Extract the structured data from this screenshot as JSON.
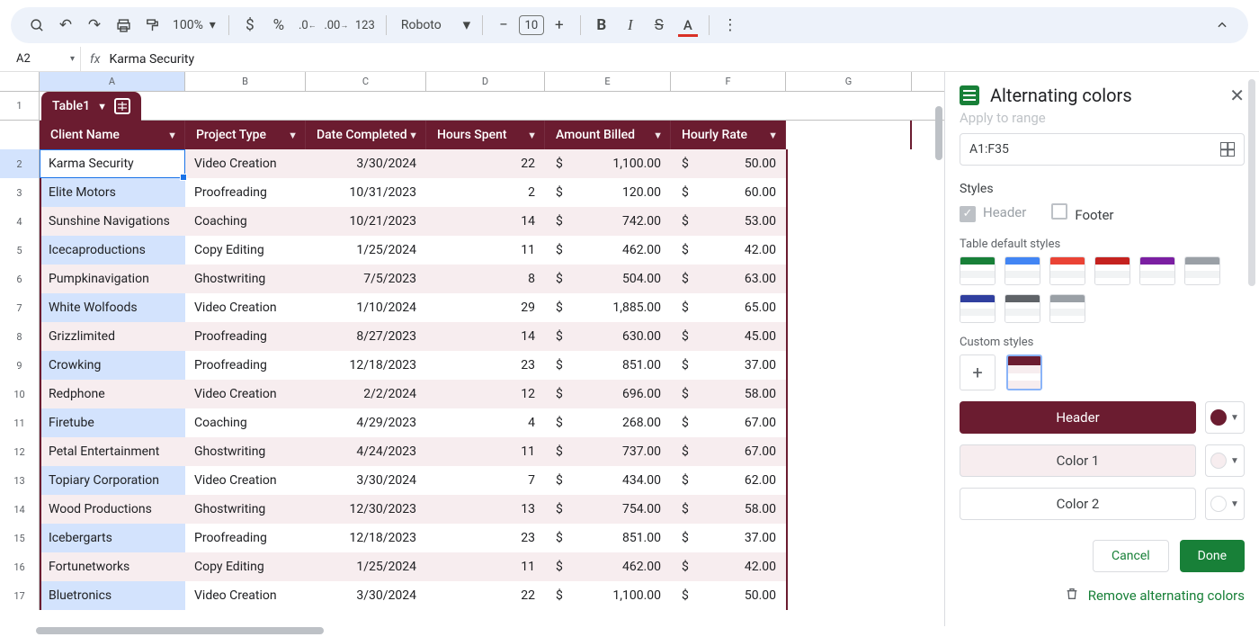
{
  "toolbar": {
    "zoom": "100%",
    "font": "Roboto",
    "font_size": "10",
    "numfmt_123": "123"
  },
  "formula_bar": {
    "cell_ref": "A2",
    "fx_label": "fx",
    "value": "Karma Security"
  },
  "columns": [
    "A",
    "B",
    "C",
    "D",
    "E",
    "F",
    "G"
  ],
  "table_chip": {
    "name": "Table1"
  },
  "headers": [
    "Client Name",
    "Project Type",
    "Date Completed",
    "Hours Spent",
    "Amount Billed",
    "Hourly Rate"
  ],
  "rows": [
    {
      "n": 2,
      "client": "Karma Security",
      "type": "Video Creation",
      "date": "3/30/2024",
      "hours": "22",
      "amount": "1,100.00",
      "rate": "50.00"
    },
    {
      "n": 3,
      "client": "Elite Motors",
      "type": "Proofreading",
      "date": "10/31/2023",
      "hours": "2",
      "amount": "120.00",
      "rate": "60.00"
    },
    {
      "n": 4,
      "client": "Sunshine Navigations",
      "type": "Coaching",
      "date": "10/21/2023",
      "hours": "14",
      "amount": "742.00",
      "rate": "53.00"
    },
    {
      "n": 5,
      "client": "Icecaproductions",
      "type": "Copy Editing",
      "date": "1/25/2024",
      "hours": "11",
      "amount": "462.00",
      "rate": "42.00"
    },
    {
      "n": 6,
      "client": "Pumpkinavigation",
      "type": "Ghostwriting",
      "date": "7/5/2023",
      "hours": "8",
      "amount": "504.00",
      "rate": "63.00"
    },
    {
      "n": 7,
      "client": "White Wolfoods",
      "type": "Video Creation",
      "date": "1/10/2024",
      "hours": "29",
      "amount": "1,885.00",
      "rate": "65.00"
    },
    {
      "n": 8,
      "client": "Grizzlimited",
      "type": "Proofreading",
      "date": "8/27/2023",
      "hours": "14",
      "amount": "630.00",
      "rate": "45.00"
    },
    {
      "n": 9,
      "client": "Crowking",
      "type": "Proofreading",
      "date": "12/18/2023",
      "hours": "23",
      "amount": "851.00",
      "rate": "37.00"
    },
    {
      "n": 10,
      "client": "Redphone",
      "type": "Video Creation",
      "date": "2/2/2024",
      "hours": "12",
      "amount": "696.00",
      "rate": "58.00"
    },
    {
      "n": 11,
      "client": "Firetube",
      "type": "Coaching",
      "date": "4/29/2023",
      "hours": "4",
      "amount": "268.00",
      "rate": "67.00"
    },
    {
      "n": 12,
      "client": "Petal Entertainment",
      "type": "Ghostwriting",
      "date": "4/24/2023",
      "hours": "11",
      "amount": "737.00",
      "rate": "67.00"
    },
    {
      "n": 13,
      "client": "Topiary Corporation",
      "type": "Video Creation",
      "date": "3/30/2024",
      "hours": "7",
      "amount": "434.00",
      "rate": "62.00"
    },
    {
      "n": 14,
      "client": "Wood Productions",
      "type": "Ghostwriting",
      "date": "12/30/2023",
      "hours": "13",
      "amount": "754.00",
      "rate": "58.00"
    },
    {
      "n": 15,
      "client": "Icebergarts",
      "type": "Proofreading",
      "date": "12/18/2023",
      "hours": "23",
      "amount": "851.00",
      "rate": "37.00"
    },
    {
      "n": 16,
      "client": "Fortunetworks",
      "type": "Copy Editing",
      "date": "1/25/2024",
      "hours": "11",
      "amount": "462.00",
      "rate": "42.00"
    },
    {
      "n": 17,
      "client": "Bluetronics",
      "type": "Video Creation",
      "date": "3/30/2024",
      "hours": "22",
      "amount": "1,100.00",
      "rate": "50.00"
    }
  ],
  "panel": {
    "title": "Alternating colors",
    "apply_label_cut": "Apply to range",
    "range": "A1:F35",
    "styles_label": "Styles",
    "header_chk": "Header",
    "footer_chk": "Footer",
    "default_label": "Table default styles",
    "default_colors": [
      "#188038",
      "#4285f4",
      "#ea4335",
      "#c5221f",
      "#7b1fa2",
      "#9aa0a6",
      "#303f9f",
      "#5f6368",
      "#9aa0a6"
    ],
    "custom_label": "Custom styles",
    "row_header": "Header",
    "row_c1": "Color 1",
    "row_c2": "Color 2",
    "pick_header": "#6b1c30",
    "pick_c1": "#f7edef",
    "pick_c2": "#ffffff",
    "cancel": "Cancel",
    "done": "Done",
    "remove": "Remove alternating colors"
  }
}
